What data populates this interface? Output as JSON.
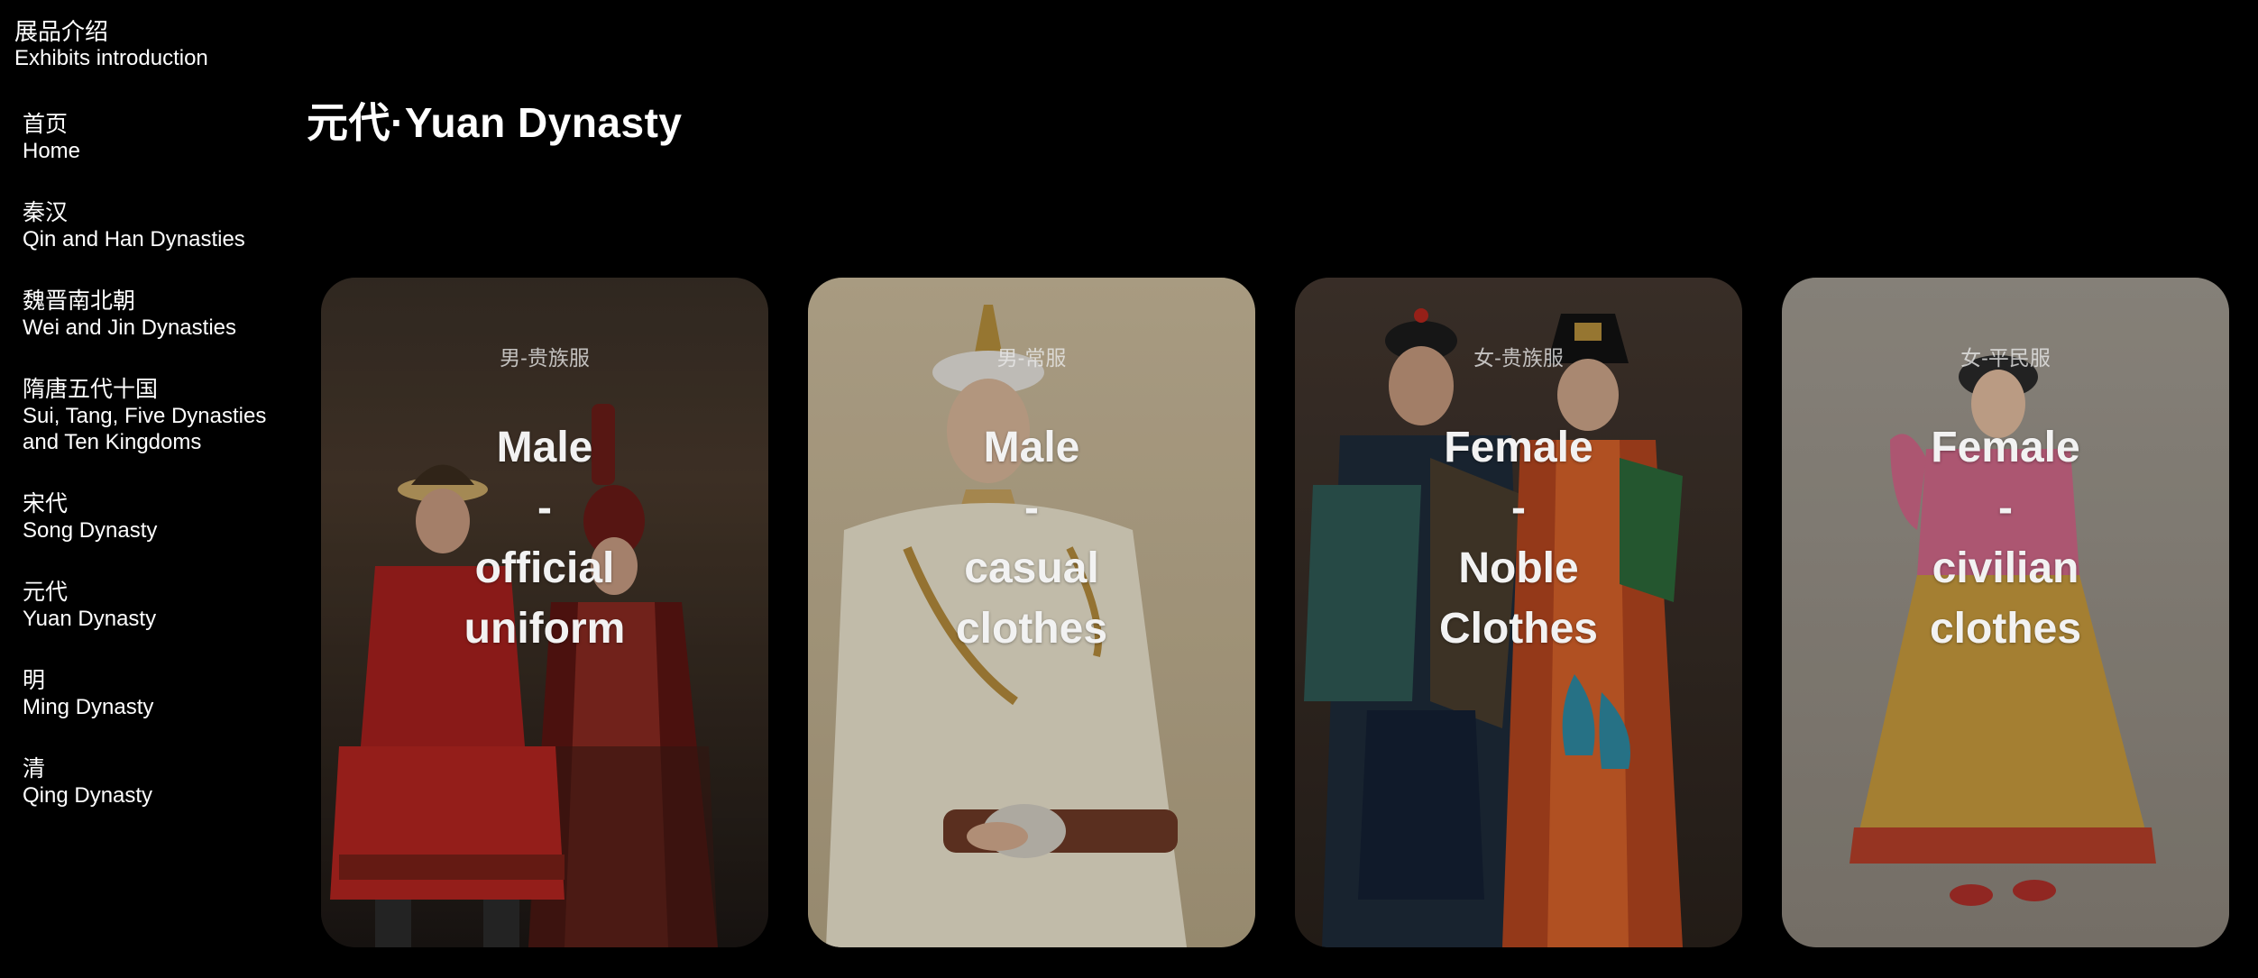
{
  "header": {
    "title_zh": "展品介绍",
    "title_en": "Exhibits introduction"
  },
  "sidebar": {
    "items": [
      {
        "zh": "首页",
        "en": "Home"
      },
      {
        "zh": "秦汉",
        "en": "Qin and Han Dynasties"
      },
      {
        "zh": "魏晋南北朝",
        "en": "Wei and Jin Dynasties"
      },
      {
        "zh": "隋唐五代十国",
        "en": "Sui, Tang, Five Dynasties and Ten Kingdoms"
      },
      {
        "zh": "宋代",
        "en": "Song Dynasty"
      },
      {
        "zh": "元代",
        "en": "Yuan Dynasty"
      },
      {
        "zh": "明",
        "en": "Ming Dynasty"
      },
      {
        "zh": "清",
        "en": "Qing Dynasty"
      }
    ]
  },
  "main": {
    "title": "元代·Yuan Dynasty",
    "cards": [
      {
        "zh": "男-贵族服",
        "en_lines": [
          "Male",
          "-",
          "official",
          "uniform"
        ]
      },
      {
        "zh": "男-常服",
        "en_lines": [
          "Male",
          "-",
          "casual",
          "clothes"
        ]
      },
      {
        "zh": "女-贵族服",
        "en_lines": [
          "Female",
          "-",
          "Noble",
          "Clothes"
        ]
      },
      {
        "zh": "女-平民服",
        "en_lines": [
          "Female",
          "-",
          "civilian",
          "clothes"
        ]
      }
    ]
  },
  "colors": {
    "background": "#000000",
    "text": "#ffffff",
    "card1_bg": "#2b2420",
    "card2_bg": "#c9b998",
    "card3_bg": "#3a3029",
    "card4_bg": "#9c958b"
  }
}
